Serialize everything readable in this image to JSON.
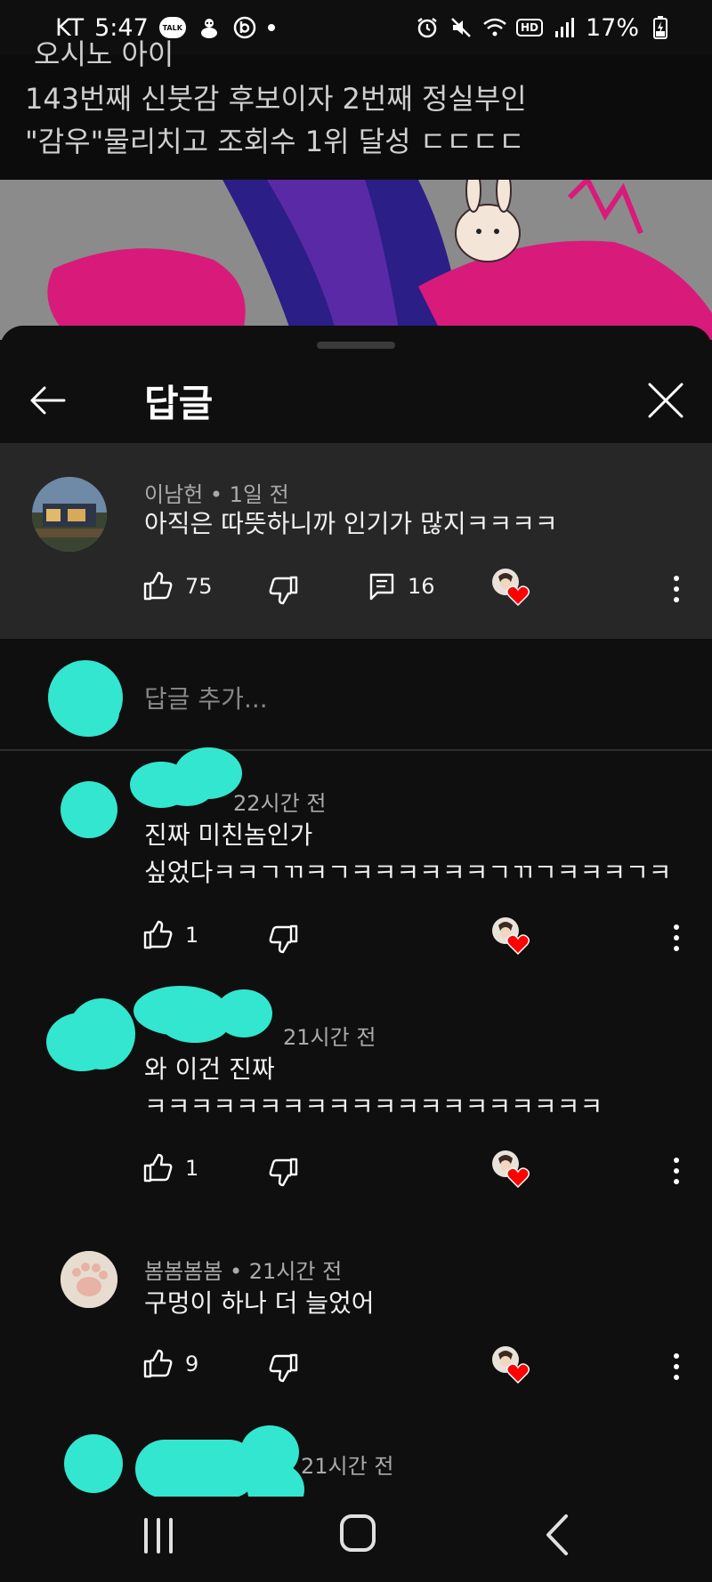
{
  "status_bar": {
    "carrier": "KT",
    "time": "5:47",
    "talk_badge": "TALK",
    "hd_label": "HD",
    "battery": "17%"
  },
  "video": {
    "title_cut": "오시노 아이",
    "title_line1": "143번째 신붓감 후보이자 2번째 정실부인",
    "title_line2": "\"감우\"물리치고 조회수 1위 달성 ㄷㄷㄷㄷ"
  },
  "sheet": {
    "title": "답글"
  },
  "parent": {
    "author": "이남헌",
    "time": "1일 전",
    "text": "아직은 따뜻하니까 인기가 많지ㅋㅋㅋㅋ",
    "likes": "75",
    "replies": "16"
  },
  "add_reply": {
    "placeholder": "답글 추가..."
  },
  "replies": [
    {
      "time": "22시간 전",
      "line1": "진짜 미친놈인가",
      "line2": "싶었다ㅋㅋㄱㄲㅋㄱㅋㅋㅋㅋㅋㅋㄱㄲㄱㅋㅋㅋㄱㅋ",
      "likes": "1"
    },
    {
      "time": "21시간 전",
      "line1": "와 이건 진짜",
      "line2": "ㅋㅋㅋㅋㅋㅋㅋㅋㅋㅋㅋㅋㅋㅋㅋㅋㅋㅋㅋㅋ",
      "likes": "1"
    },
    {
      "author": "봄봄봄봄",
      "time": "21시간 전",
      "line1": "구멍이 하나 더 늘었어",
      "likes": "9"
    },
    {
      "time": "21시간 전"
    }
  ],
  "colors": {
    "background": "#0f0f0f",
    "highlight": "#272727",
    "redaction": "#33e6cf",
    "heart": "#ff0000"
  },
  "icons": [
    "arrow-left-icon",
    "close-icon",
    "thumb-up-icon",
    "thumb-down-icon",
    "comment-icon",
    "creator-heart-icon",
    "more-vert-icon"
  ]
}
